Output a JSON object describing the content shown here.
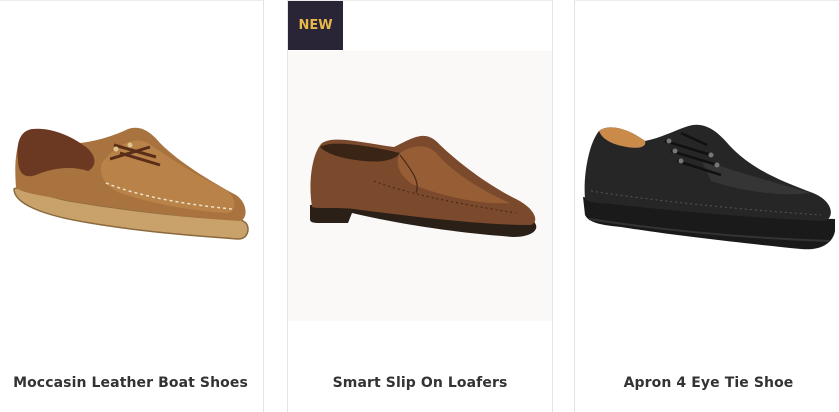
{
  "products": [
    {
      "title": "Moccasin Leather Boat Shoes",
      "image_icon": "brown-boat-shoe-image"
    },
    {
      "title": "Smart Slip On Loafers",
      "badge": "NEW",
      "image_icon": "brown-loafer-image"
    },
    {
      "title": "Apron 4 Eye Tie Shoe",
      "image_icon": "black-tie-shoe-image"
    }
  ],
  "colors": {
    "badge_bg": "#2a2437",
    "badge_text": "#e9b84a",
    "title_text": "#333333",
    "border": "#e3e3e3"
  }
}
